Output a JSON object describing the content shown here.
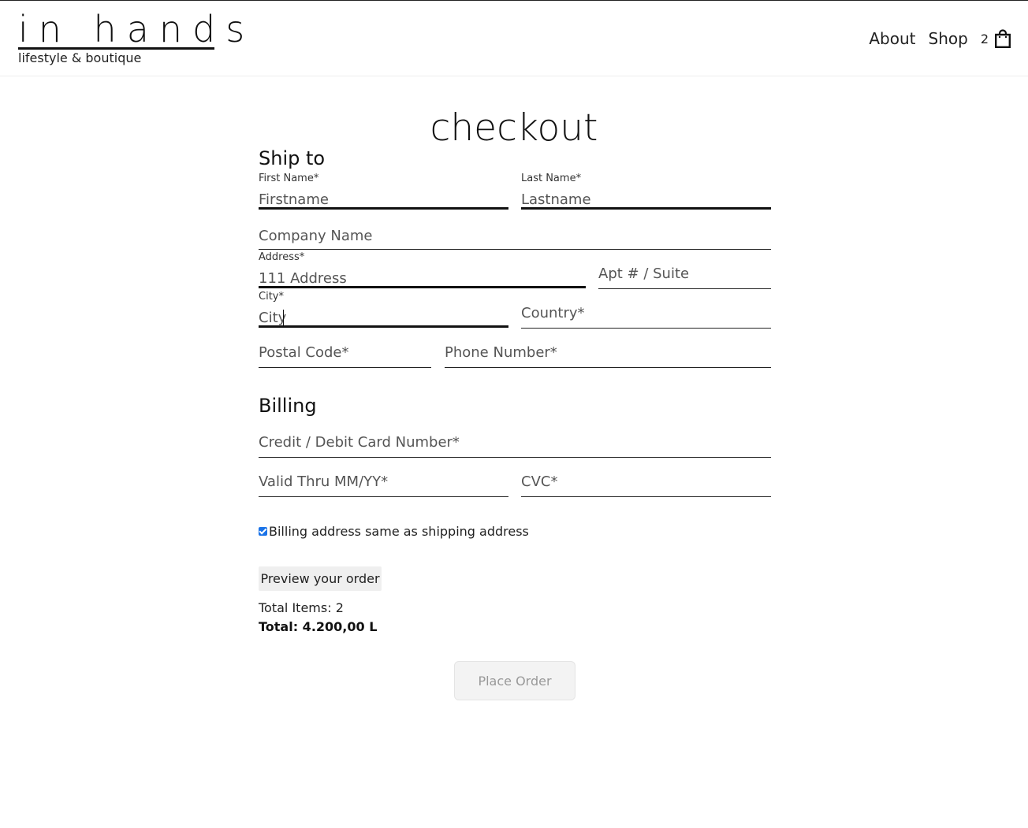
{
  "header": {
    "logo_title": "in hands",
    "logo_subtitle": "lifestyle & boutique",
    "nav": {
      "about": "About",
      "shop": "Shop"
    },
    "cart_count": "2"
  },
  "page": {
    "title": "checkout"
  },
  "shipping": {
    "section_title": "Ship to",
    "first_name": {
      "label": "First Name*",
      "placeholder": "Firstname"
    },
    "last_name": {
      "label": "Last Name*",
      "placeholder": "Lastname"
    },
    "company": {
      "placeholder": "Company Name"
    },
    "address": {
      "label": "Address*",
      "placeholder": "111 Address"
    },
    "apt": {
      "placeholder": "Apt # / Suite"
    },
    "city": {
      "label": "City*",
      "placeholder": "City"
    },
    "country": {
      "placeholder": "Country*"
    },
    "postal": {
      "placeholder": "Postal Code*"
    },
    "phone": {
      "placeholder": "Phone Number*"
    }
  },
  "billing": {
    "section_title": "Billing",
    "card": {
      "placeholder": "Credit / Debit Card Number*"
    },
    "valid_thru": {
      "placeholder": "Valid Thru MM/YY*"
    },
    "cvc": {
      "placeholder": "CVC*"
    },
    "same_address_label": "Billing address same as shipping address",
    "same_address_checked": true
  },
  "summary": {
    "preview_button": "Preview your order",
    "total_items": "Total Items: 2",
    "total": "Total: 4.200,00 L",
    "place_order_button": "Place Order"
  },
  "colors": {
    "checkbox_accent": "#1a73e8",
    "text": "#111111"
  }
}
